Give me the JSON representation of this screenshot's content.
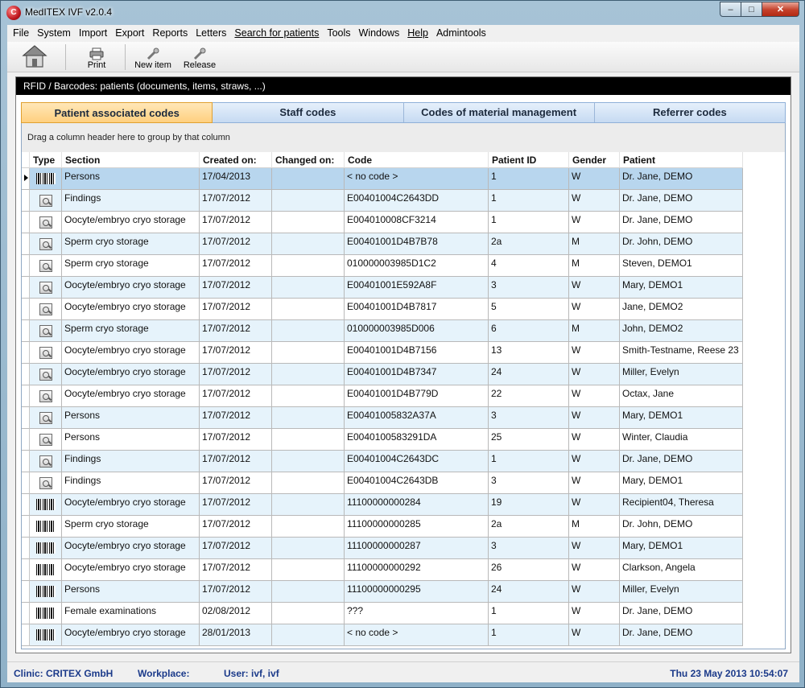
{
  "window": {
    "title": "MedITEX IVF v2.0.4",
    "app_icon": "C",
    "min": "–",
    "max": "□",
    "close": "✕"
  },
  "menu": [
    {
      "label": "File",
      "ul": false
    },
    {
      "label": "System",
      "ul": false
    },
    {
      "label": "Import",
      "ul": false
    },
    {
      "label": "Export",
      "ul": false
    },
    {
      "label": "Reports",
      "ul": false
    },
    {
      "label": "Letters",
      "ul": false
    },
    {
      "label": "Search for patients",
      "ul": true
    },
    {
      "label": "Tools",
      "ul": false
    },
    {
      "label": "Windows",
      "ul": false
    },
    {
      "label": "Help",
      "ul": true
    },
    {
      "label": "Admintools",
      "ul": false
    }
  ],
  "toolbar": {
    "print": "Print",
    "new_item": "New item",
    "release": "Release"
  },
  "panel": {
    "title": "RFID / Barcodes: patients (documents, items, straws, ...)"
  },
  "tabs": [
    "Patient associated codes",
    "Staff codes",
    "Codes of material management",
    "Referrer codes"
  ],
  "grid": {
    "group_hint": "Drag a column header here to group by that column",
    "columns": [
      "Type",
      "Section",
      "Created on:",
      "Changed on:",
      "Code",
      "Patient ID",
      "Gender",
      "Patient"
    ],
    "rows": [
      {
        "type": "barcode",
        "section": "Persons",
        "created": "17/04/2013",
        "changed": "",
        "code": "< no code >",
        "pid": "1",
        "gender": "W",
        "patient": "Dr. Jane, DEMO"
      },
      {
        "type": "rfid",
        "section": "Findings",
        "created": "17/07/2012",
        "changed": "",
        "code": "E00401004C2643DD",
        "pid": "1",
        "gender": "W",
        "patient": "Dr. Jane, DEMO"
      },
      {
        "type": "rfid",
        "section": "Oocyte/embryo cryo storage",
        "created": "17/07/2012",
        "changed": "",
        "code": "E004010008CF3214",
        "pid": "1",
        "gender": "W",
        "patient": "Dr. Jane, DEMO"
      },
      {
        "type": "rfid",
        "section": "Sperm cryo storage",
        "created": "17/07/2012",
        "changed": "",
        "code": "E00401001D4B7B78",
        "pid": "2a",
        "gender": "M",
        "patient": "Dr. John, DEMO"
      },
      {
        "type": "rfid",
        "section": "Sperm cryo storage",
        "created": "17/07/2012",
        "changed": "",
        "code": "010000003985D1C2",
        "pid": "4",
        "gender": "M",
        "patient": "Steven, DEMO1"
      },
      {
        "type": "rfid",
        "section": "Oocyte/embryo cryo storage",
        "created": "17/07/2012",
        "changed": "",
        "code": "E00401001E592A8F",
        "pid": "3",
        "gender": "W",
        "patient": "Mary, DEMO1"
      },
      {
        "type": "rfid",
        "section": "Oocyte/embryo cryo storage",
        "created": "17/07/2012",
        "changed": "",
        "code": "E00401001D4B7817",
        "pid": "5",
        "gender": "W",
        "patient": "Jane, DEMO2"
      },
      {
        "type": "rfid",
        "section": "Sperm cryo storage",
        "created": "17/07/2012",
        "changed": "",
        "code": "010000003985D006",
        "pid": "6",
        "gender": "M",
        "patient": "John, DEMO2"
      },
      {
        "type": "rfid",
        "section": "Oocyte/embryo cryo storage",
        "created": "17/07/2012",
        "changed": "",
        "code": "E00401001D4B7156",
        "pid": "13",
        "gender": "W",
        "patient": "Smith-Testname, Reese 23"
      },
      {
        "type": "rfid",
        "section": "Oocyte/embryo cryo storage",
        "created": "17/07/2012",
        "changed": "",
        "code": "E00401001D4B7347",
        "pid": "24",
        "gender": "W",
        "patient": "Miller, Evelyn"
      },
      {
        "type": "rfid",
        "section": "Oocyte/embryo cryo storage",
        "created": "17/07/2012",
        "changed": "",
        "code": "E00401001D4B779D",
        "pid": "22",
        "gender": "W",
        "patient": "Octax, Jane"
      },
      {
        "type": "rfid",
        "section": "Persons",
        "created": "17/07/2012",
        "changed": "",
        "code": "E00401005832A37A",
        "pid": "3",
        "gender": "W",
        "patient": "Mary, DEMO1"
      },
      {
        "type": "rfid",
        "section": "Persons",
        "created": "17/07/2012",
        "changed": "",
        "code": "E0040100583291DA",
        "pid": "25",
        "gender": "W",
        "patient": "Winter, Claudia"
      },
      {
        "type": "rfid",
        "section": "Findings",
        "created": "17/07/2012",
        "changed": "",
        "code": "E00401004C2643DC",
        "pid": "1",
        "gender": "W",
        "patient": "Dr. Jane, DEMO"
      },
      {
        "type": "rfid",
        "section": "Findings",
        "created": "17/07/2012",
        "changed": "",
        "code": "E00401004C2643DB",
        "pid": "3",
        "gender": "W",
        "patient": "Mary, DEMO1"
      },
      {
        "type": "barcode",
        "section": "Oocyte/embryo cryo storage",
        "created": "17/07/2012",
        "changed": "",
        "code": "11100000000284",
        "pid": "19",
        "gender": "W",
        "patient": "Recipient04, Theresa"
      },
      {
        "type": "barcode",
        "section": "Sperm cryo storage",
        "created": "17/07/2012",
        "changed": "",
        "code": "11100000000285",
        "pid": "2a",
        "gender": "M",
        "patient": "Dr. John, DEMO"
      },
      {
        "type": "barcode",
        "section": "Oocyte/embryo cryo storage",
        "created": "17/07/2012",
        "changed": "",
        "code": "11100000000287",
        "pid": "3",
        "gender": "W",
        "patient": "Mary, DEMO1"
      },
      {
        "type": "barcode",
        "section": "Oocyte/embryo cryo storage",
        "created": "17/07/2012",
        "changed": "",
        "code": "11100000000292",
        "pid": "26",
        "gender": "W",
        "patient": "Clarkson, Angela"
      },
      {
        "type": "barcode",
        "section": "Persons",
        "created": "17/07/2012",
        "changed": "",
        "code": "11100000000295",
        "pid": "24",
        "gender": "W",
        "patient": "Miller, Evelyn"
      },
      {
        "type": "barcode",
        "section": "Female examinations",
        "created": "02/08/2012",
        "changed": "",
        "code": "???",
        "pid": "1",
        "gender": "W",
        "patient": "Dr. Jane, DEMO"
      },
      {
        "type": "barcode",
        "section": "Oocyte/embryo cryo storage",
        "created": "28/01/2013",
        "changed": "",
        "code": "< no code >",
        "pid": "1",
        "gender": "W",
        "patient": "Dr. Jane, DEMO"
      }
    ]
  },
  "status": {
    "clinic": "Clinic: CRITEX GmbH",
    "workplace": "Workplace:",
    "user": "User: ivf, ivf",
    "datetime": "Thu 23 May 2013 10:54:07"
  }
}
